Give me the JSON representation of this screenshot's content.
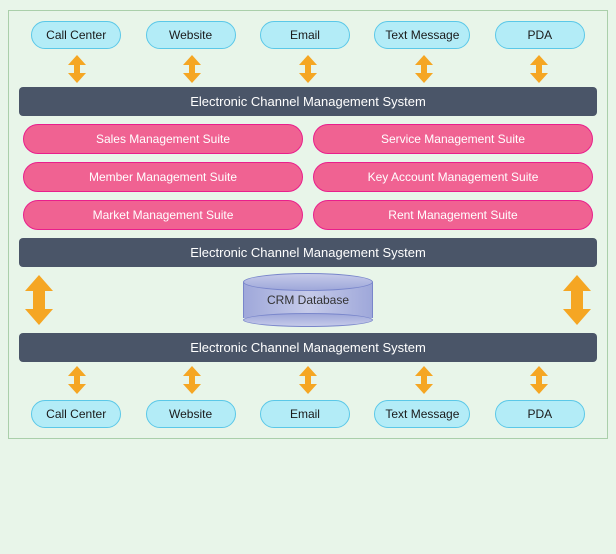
{
  "top_channels": [
    {
      "label": "Call Center"
    },
    {
      "label": "Website"
    },
    {
      "label": "Email"
    },
    {
      "label": "Text Message"
    },
    {
      "label": "PDA"
    }
  ],
  "bottom_channels": [
    {
      "label": "Call Center"
    },
    {
      "label": "Website"
    },
    {
      "label": "Email"
    },
    {
      "label": "Text Message"
    },
    {
      "label": "PDA"
    }
  ],
  "bars": {
    "top": "Electronic Channel Management System",
    "middle": "Electronic Channel Management System",
    "bottom": "Electronic Channel Management System"
  },
  "suites_left": [
    {
      "label": "Sales Management Suite"
    },
    {
      "label": "Member Management Suite"
    },
    {
      "label": "Market Management Suite"
    }
  ],
  "suites_right": [
    {
      "label": "Service Management Suite"
    },
    {
      "label": "Key Account Management Suite"
    },
    {
      "label": "Rent Management Suite"
    }
  ],
  "crm": {
    "label": "CRM Database"
  },
  "colors": {
    "channel_bg": "#b3ecf7",
    "channel_border": "#5bc8e8",
    "bar_bg": "#4a5568",
    "suite_bg": "#f06292",
    "arrow_color": "#f5a623"
  }
}
